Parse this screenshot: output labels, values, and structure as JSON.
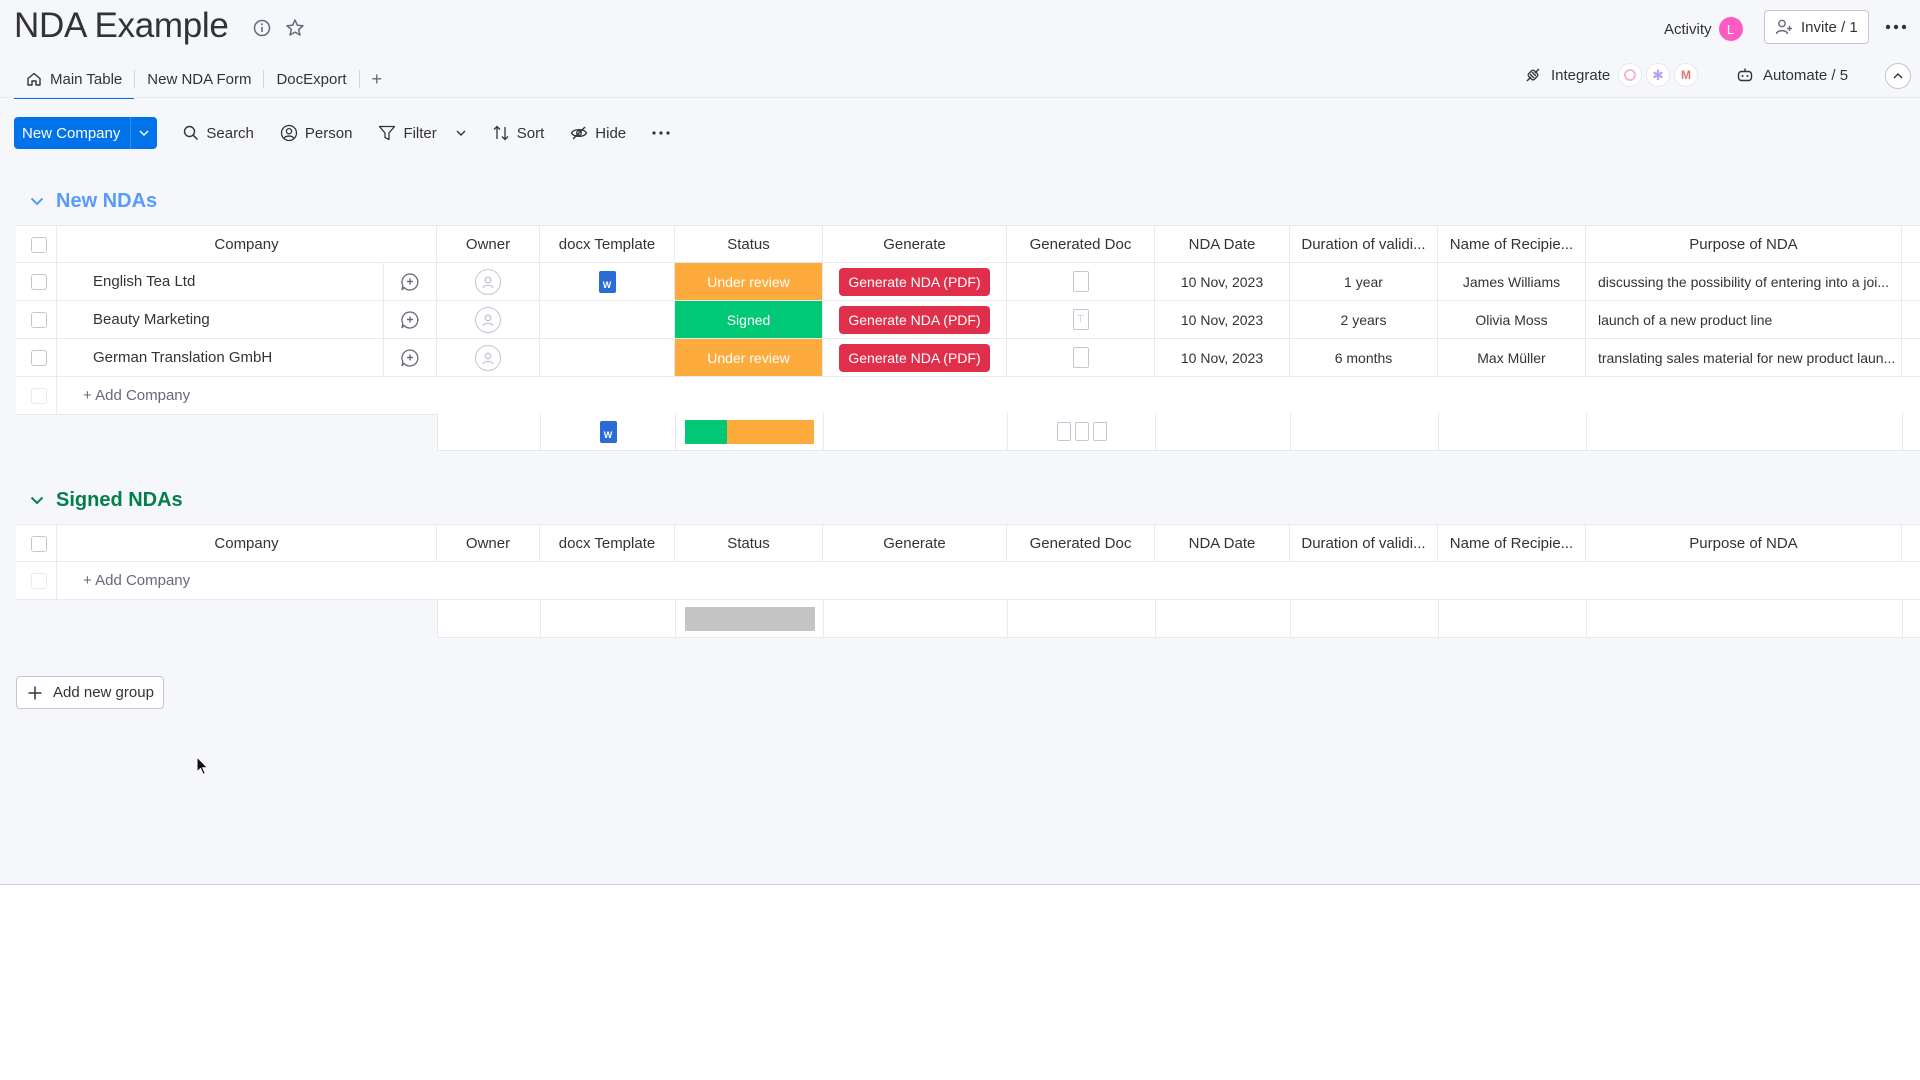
{
  "board": {
    "title": "NDA Example"
  },
  "header": {
    "activity_label": "Activity",
    "activity_avatar": "L",
    "invite_label": "Invite / 1"
  },
  "tabs": [
    {
      "label": "Main Table",
      "icon": "home-icon",
      "active": true
    },
    {
      "label": "New NDA Form"
    },
    {
      "label": "DocExport"
    },
    {
      "label": "+"
    }
  ],
  "right_tools": {
    "integrate_label": "Integrate",
    "automate_label": "Automate / 5"
  },
  "toolbar": {
    "new_label": "New Company",
    "search_label": "Search",
    "person_label": "Person",
    "filter_label": "Filter",
    "sort_label": "Sort",
    "hide_label": "Hide"
  },
  "columns": [
    "Company",
    "Owner",
    "docx Template",
    "Status",
    "Generate",
    "Generated Doc",
    "NDA Date",
    "Duration of validi...",
    "Name of Recipie...",
    "Purpose of NDA"
  ],
  "groups": [
    {
      "name": "New NDAs",
      "color": "#579bfc",
      "add_label": "+ Add Company",
      "rows": [
        {
          "company": "English Tea Ltd",
          "status": "Under review",
          "status_color": "#fdab3d",
          "generate": "Generate NDA (PDF)",
          "date": "10 Nov, 2023",
          "duration": "1 year",
          "recipient": "James Williams",
          "purpose": "discussing the possibility of entering into a joi..."
        },
        {
          "company": "Beauty Marketing",
          "status": "Signed",
          "status_color": "#00c875",
          "generate": "Generate NDA (PDF)",
          "date": "10 Nov, 2023",
          "duration": "2 years",
          "recipient": "Olivia Moss",
          "purpose": "launch of a new product line"
        },
        {
          "company": "German Translation GmbH",
          "status": "Under review",
          "status_color": "#fdab3d",
          "generate": "Generate NDA (PDF)",
          "date": "10 Nov, 2023",
          "duration": "6 months",
          "recipient": "Max Müller",
          "purpose": "translating sales material for new product laun..."
        }
      ],
      "status_summary": [
        {
          "color": "#00c875",
          "fraction": 0.33
        },
        {
          "color": "#fdab3d",
          "fraction": 0.67
        }
      ]
    },
    {
      "name": "Signed NDAs",
      "color": "#037f4c",
      "add_label": "+ Add Company",
      "rows": [],
      "status_summary": [
        {
          "color": "#c4c4c4",
          "fraction": 1.0
        }
      ]
    }
  ],
  "add_group_label": "Add new group",
  "colors": {
    "primary": "#0073ea",
    "danger": "#df2f4a"
  }
}
